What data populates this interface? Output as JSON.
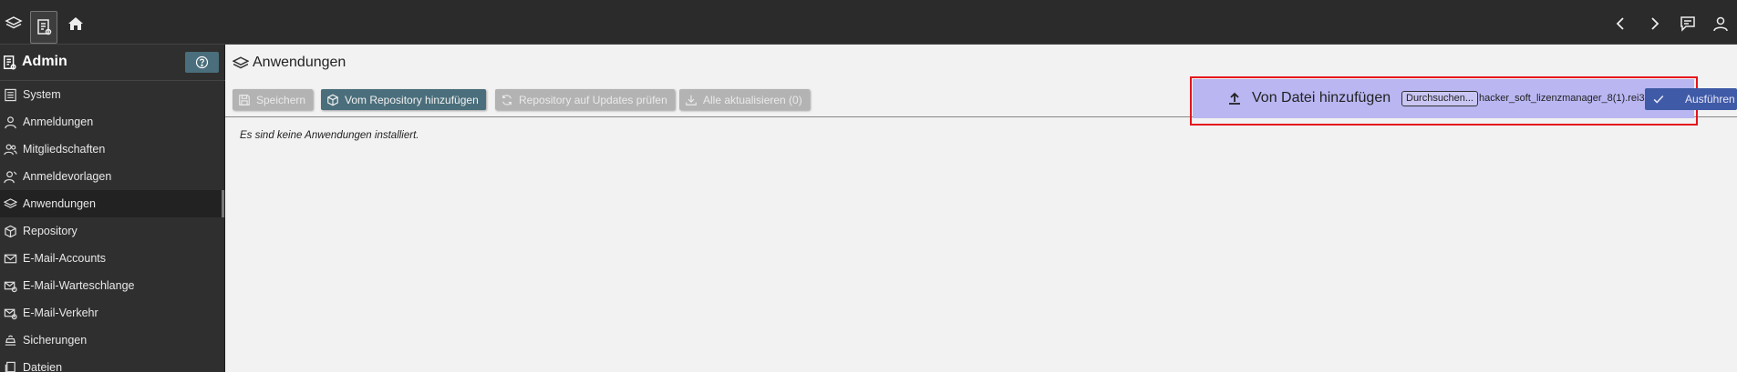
{
  "topbar": {
    "icons": [
      "layers-icon",
      "admin-doc-icon",
      "home-icon"
    ],
    "right_icons": [
      "chevron-left-icon",
      "chevron-right-icon",
      "feedback-icon",
      "user-icon"
    ]
  },
  "sidebar": {
    "title": "Admin",
    "items": [
      {
        "label": "System",
        "icon": "doc-list-icon"
      },
      {
        "label": "Anmeldungen",
        "icon": "user-icon"
      },
      {
        "label": "Mitgliedschaften",
        "icon": "users-icon"
      },
      {
        "label": "Anmeldevorlagen",
        "icon": "user-template-icon"
      },
      {
        "label": "Anwendungen",
        "icon": "layers-icon",
        "active": true
      },
      {
        "label": "Repository",
        "icon": "cube-icon"
      },
      {
        "label": "E-Mail-Accounts",
        "icon": "mail-icon"
      },
      {
        "label": "E-Mail-Warteschlange",
        "icon": "mail-queue-icon"
      },
      {
        "label": "E-Mail-Verkehr",
        "icon": "mail-traffic-icon"
      },
      {
        "label": "Sicherungen",
        "icon": "backup-icon"
      },
      {
        "label": "Dateien",
        "icon": "files-icon"
      }
    ]
  },
  "main": {
    "title": "Anwendungen",
    "toolbar": {
      "save": "Speichern",
      "add_repo": "Vom Repository hinzufügen",
      "check_updates": "Repository auf Updates prüfen",
      "update_all": "Alle aktualisieren (0)"
    },
    "empty_message": "Es sind keine Anwendungen installiert.",
    "upload": {
      "label": "Von Datei hinzufügen",
      "browse": "Durchsuchen...",
      "file_name": "hacker_soft_lizenzmanager_8(1).rei3",
      "execute": "Ausführen"
    }
  },
  "colors": {
    "topbar_bg": "#2b2b2b",
    "sidebar_bg": "#2f2f2f",
    "accent": "#4a6e7b",
    "upload_bg": "#b9b6f2",
    "highlight": "#e5141c",
    "execute_bg": "#3f5aa6"
  }
}
